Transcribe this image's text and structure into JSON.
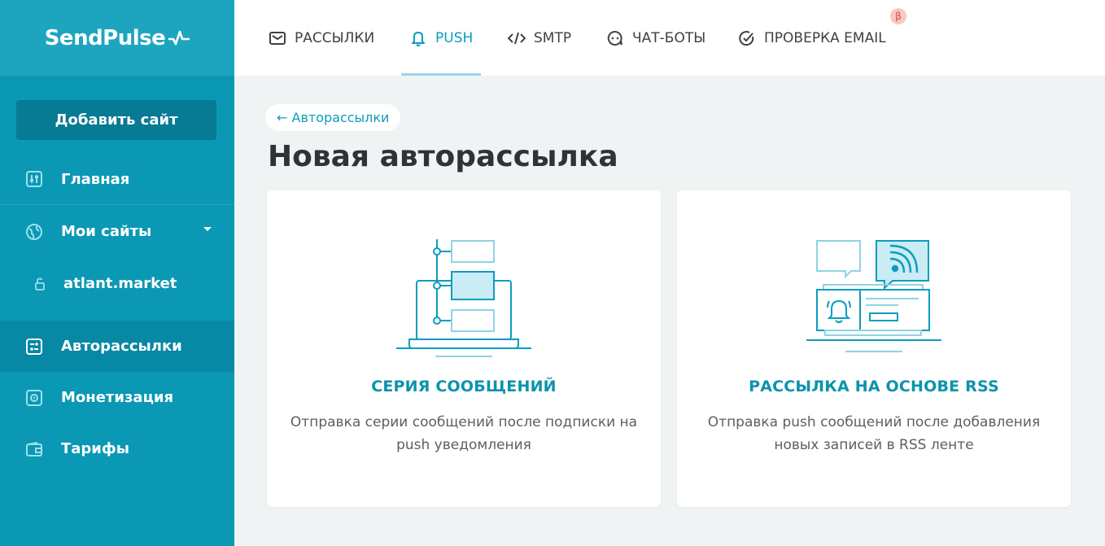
{
  "brand": {
    "name": "SendPulse"
  },
  "sidebar": {
    "add_site_label": "Добавить сайт",
    "items": [
      {
        "label": "Главная",
        "icon": "sliders-icon"
      },
      {
        "label": "Мои сайты",
        "icon": "globe-icon"
      },
      {
        "label": "atlant.market",
        "icon": "unlock-icon"
      },
      {
        "label": "Авторассылки",
        "icon": "automation-icon"
      },
      {
        "label": "Монетизация",
        "icon": "safe-icon"
      },
      {
        "label": "Тарифы",
        "icon": "wallet-icon"
      }
    ]
  },
  "topnav": {
    "tabs": [
      {
        "label": "РАССЫЛКИ",
        "icon": "envelope-icon"
      },
      {
        "label": "PUSH",
        "icon": "bell-icon",
        "active": true
      },
      {
        "label": "SMTP",
        "icon": "code-icon"
      },
      {
        "label": "ЧАТ-БОТЫ",
        "icon": "chat-bot-icon"
      },
      {
        "label": "ПРОВЕРКА EMAIL",
        "icon": "check-circle-icon"
      }
    ],
    "beta_badge": "β"
  },
  "main": {
    "back_label": "← Авторассылки",
    "title": "Новая авторассылка",
    "cards": [
      {
        "title": "СЕРИЯ СООБЩЕНИЙ",
        "description": "Отправка серии сообщений после подписки на push уведомления"
      },
      {
        "title": "РАССЫЛКА НА ОСНОВЕ RSS",
        "description": "Отправка push сообщений после добавления новых записей в RSS ленте"
      }
    ]
  },
  "colors": {
    "sidebar": "#0a98b5",
    "accent": "#0b9dbd",
    "active_item": "#0788a4"
  }
}
